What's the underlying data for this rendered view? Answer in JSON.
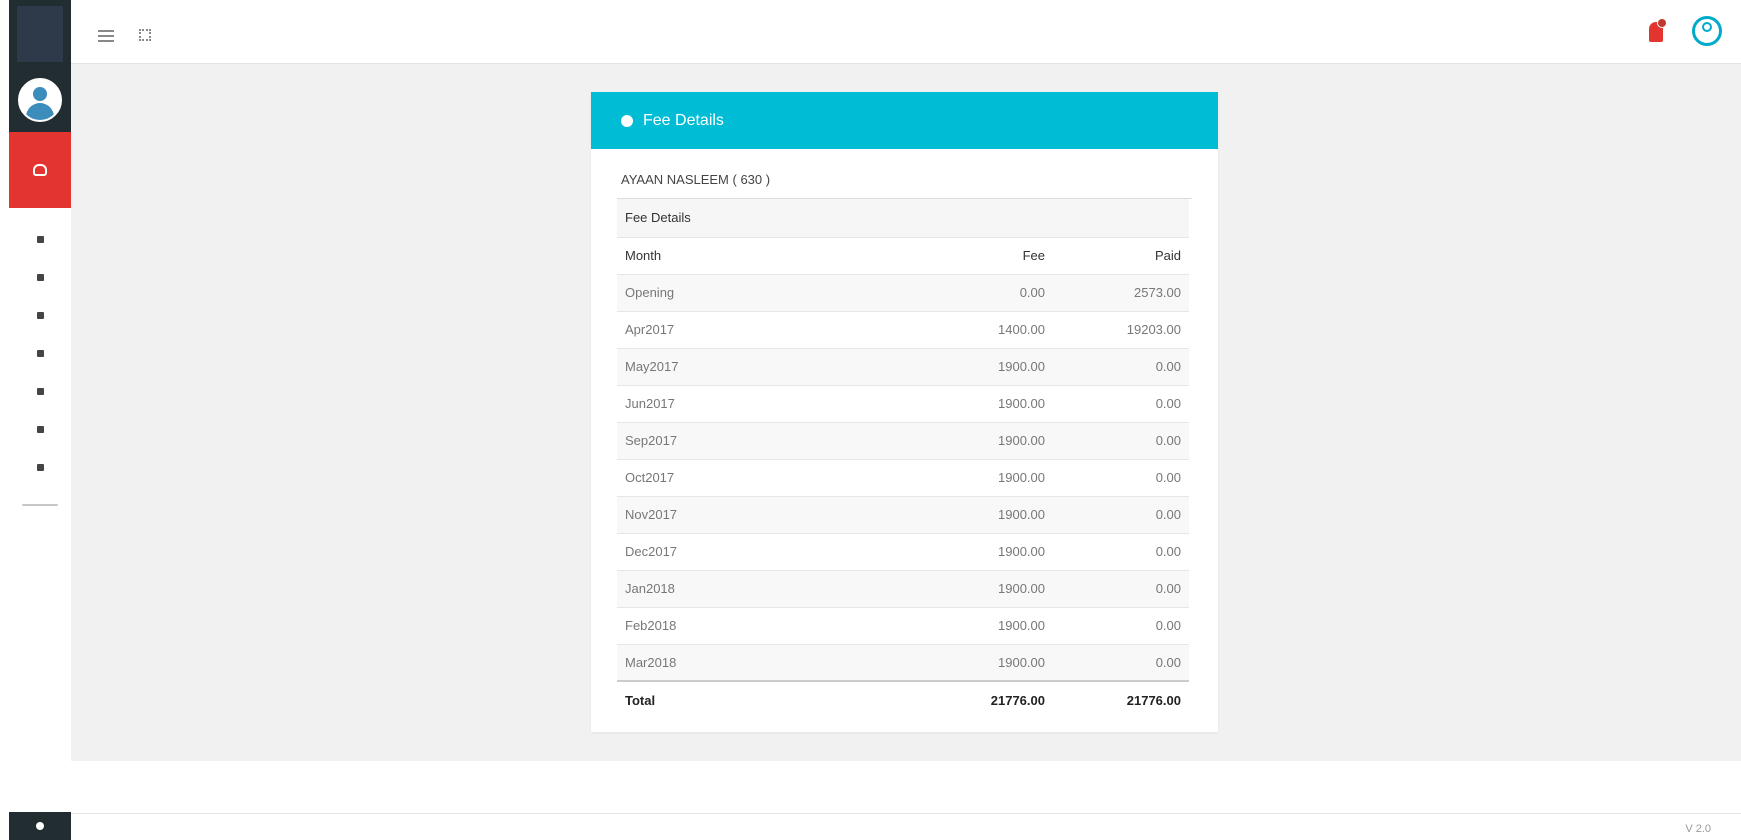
{
  "card": {
    "title": "Fee Details",
    "student": "AYAAN NASLEEM ( 630 )",
    "section_label": "Fee Details",
    "columns": {
      "month": "Month",
      "fee": "Fee",
      "paid": "Paid"
    },
    "rows": [
      {
        "month": "Opening",
        "fee": "0.00",
        "paid": "2573.00"
      },
      {
        "month": "Apr2017",
        "fee": "1400.00",
        "paid": "19203.00"
      },
      {
        "month": "May2017",
        "fee": "1900.00",
        "paid": "0.00"
      },
      {
        "month": "Jun2017",
        "fee": "1900.00",
        "paid": "0.00"
      },
      {
        "month": "Sep2017",
        "fee": "1900.00",
        "paid": "0.00"
      },
      {
        "month": "Oct2017",
        "fee": "1900.00",
        "paid": "0.00"
      },
      {
        "month": "Nov2017",
        "fee": "1900.00",
        "paid": "0.00"
      },
      {
        "month": "Dec2017",
        "fee": "1900.00",
        "paid": "0.00"
      },
      {
        "month": "Jan2018",
        "fee": "1900.00",
        "paid": "0.00"
      },
      {
        "month": "Feb2018",
        "fee": "1900.00",
        "paid": "0.00"
      },
      {
        "month": "Mar2018",
        "fee": "1900.00",
        "paid": "0.00"
      }
    ],
    "total": {
      "label": "Total",
      "fee": "21776.00",
      "paid": "21776.00"
    }
  },
  "footer": {
    "version": "V 2.0"
  },
  "colors": {
    "header": "#00bcd4",
    "sidebar_dark": "#222d32",
    "sidebar_active": "#e3342f",
    "notification": "#e3342f",
    "avatar_accent": "#00aacc"
  },
  "icons": {
    "menu": "hamburger-icon",
    "fullscreen": "expand-icon",
    "notification": "bell-icon",
    "user": "user-avatar-icon",
    "info": "info-circle-icon",
    "settings": "gear-icon"
  }
}
